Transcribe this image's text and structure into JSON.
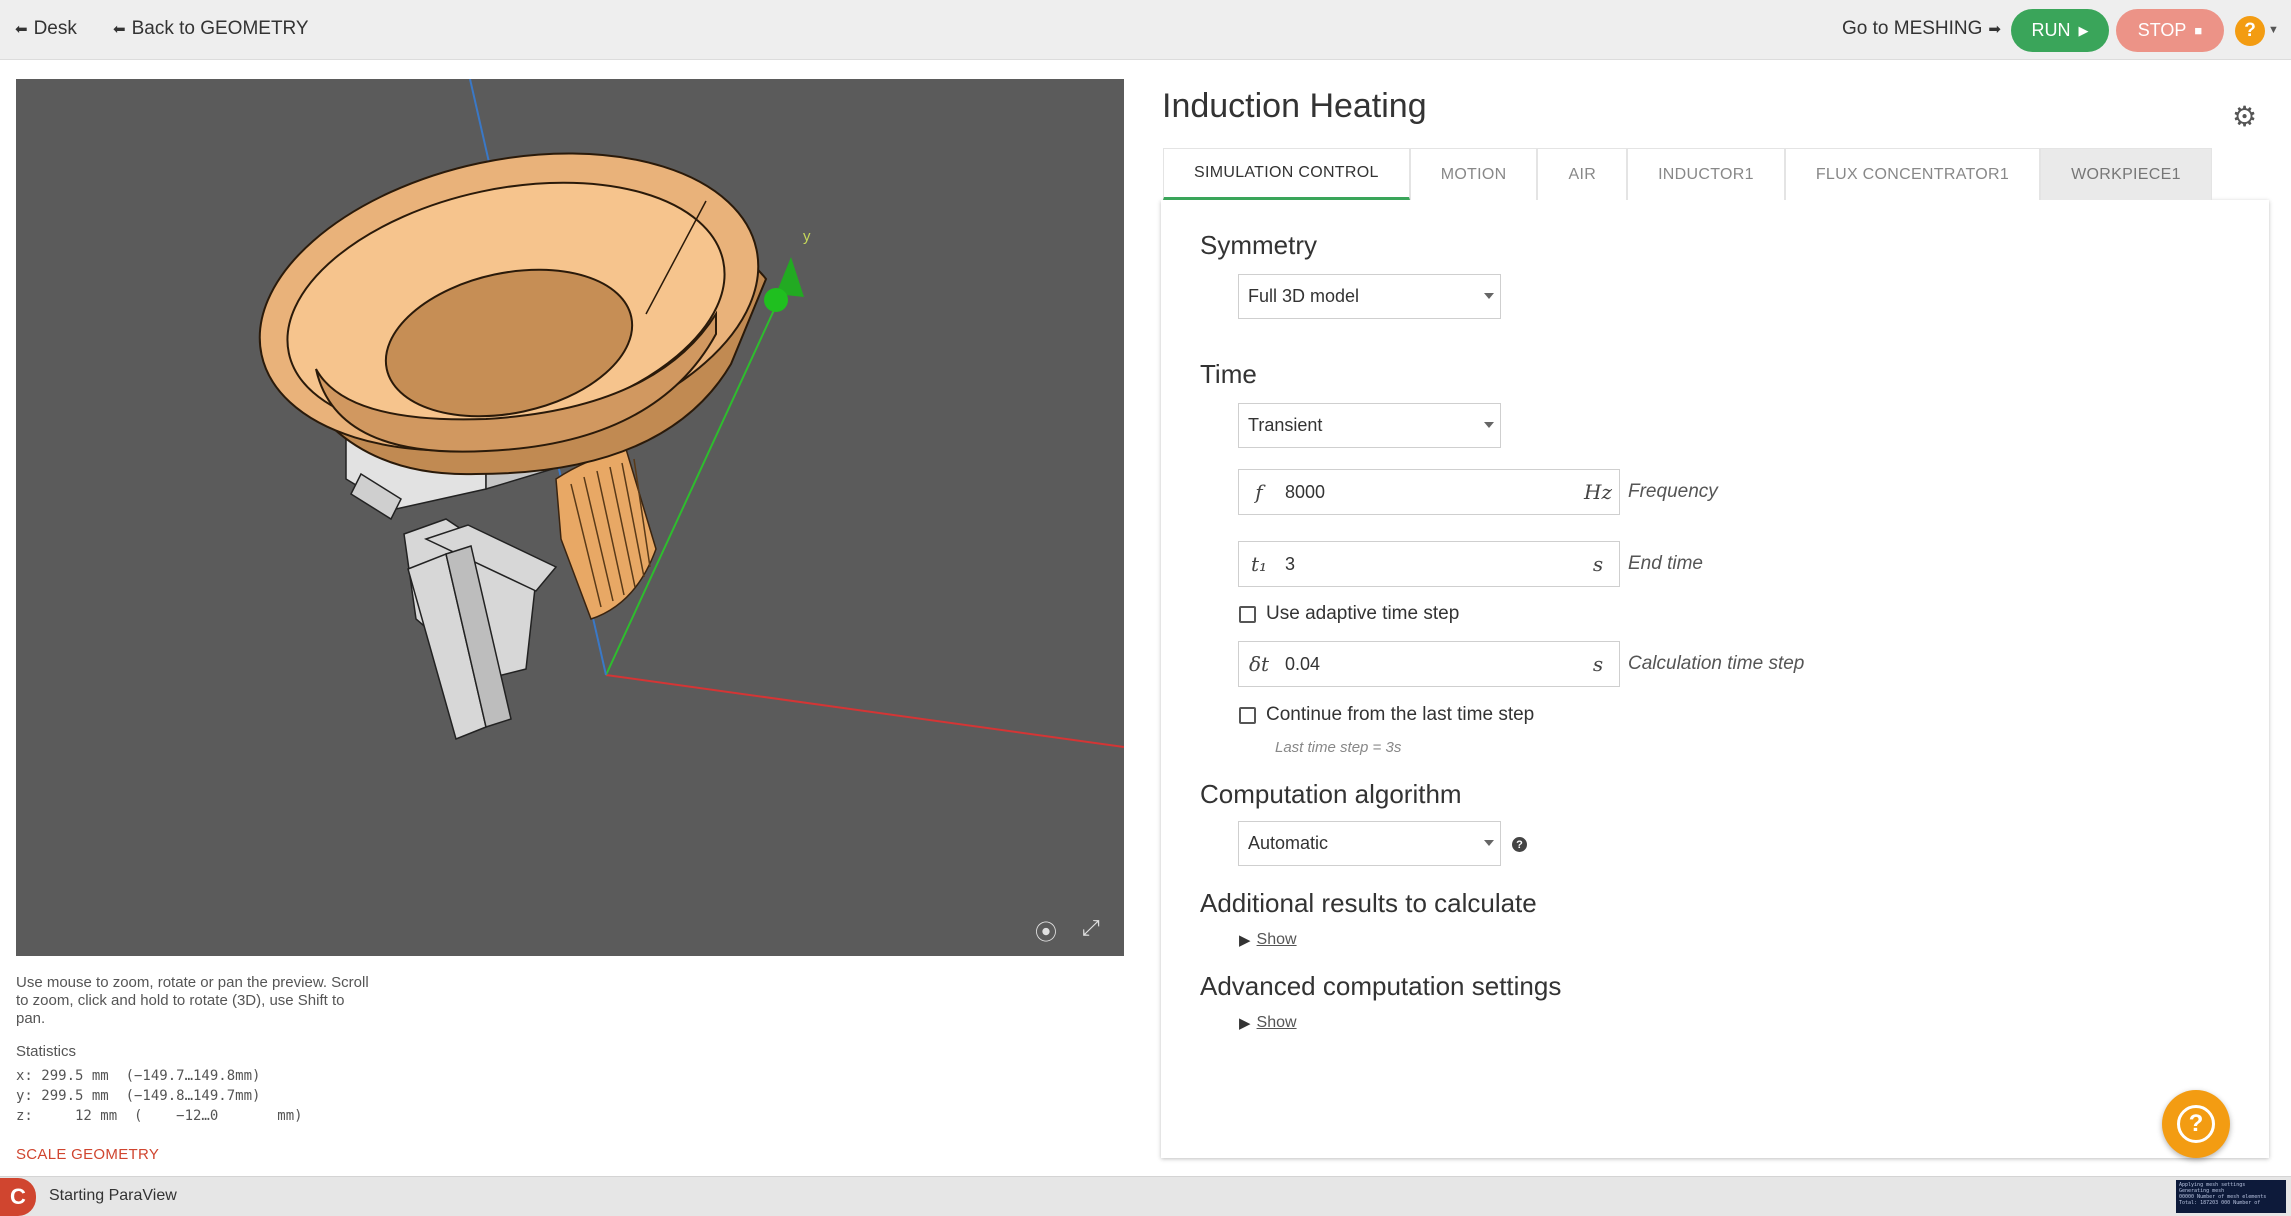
{
  "topbar": {
    "desk_label": "Desk",
    "back_label": "Back to GEOMETRY",
    "goto_label": "Go to MESHING",
    "run_label": "RUN",
    "stop_label": "STOP",
    "help_label": "?"
  },
  "viewport": {
    "axis_y_label": "y",
    "hint": "Use mouse to zoom, rotate or pan the preview. Scroll to zoom, click and hold to rotate (3D), use Shift to pan.",
    "stats_title": "Statistics",
    "stats": {
      "x": "x: 299.5 mm  (−149.7…149.8mm)",
      "y": "y: 299.5 mm  (−149.8…149.7mm)",
      "z": "z:     12 mm  (    −12…0       mm)"
    },
    "scale_label": "SCALE GEOMETRY"
  },
  "status": {
    "text": "Starting ParaView",
    "terminal": "Applying mesh settings\nGenerating mesh\n00000 Number of mesh elements\nTotal: 187203 000 Number of"
  },
  "panel": {
    "title": "Induction Heating",
    "tabs": [
      {
        "label": "SIMULATION CONTROL"
      },
      {
        "label": "MOTION"
      },
      {
        "label": "AIR"
      },
      {
        "label": "INDUCTOR1"
      },
      {
        "label": "FLUX CONCENTRATOR1"
      },
      {
        "label": "WORKPIECE1"
      }
    ],
    "symmetry": {
      "heading": "Symmetry",
      "value": "Full 3D model"
    },
    "time": {
      "heading": "Time",
      "mode": "Transient",
      "frequency": {
        "symbol": "f",
        "value": "8000",
        "unit": "Hz",
        "label": "Frequency"
      },
      "end_time": {
        "symbol": "t₁",
        "value": "3",
        "unit": "s",
        "label": "End time"
      },
      "adaptive_label": "Use adaptive time step",
      "step": {
        "symbol": "δt",
        "value": "0.04",
        "unit": "s",
        "label": "Calculation time step"
      },
      "continue_label": "Continue from the last time step",
      "last_step_hint": "Last time step = 3s"
    },
    "algorithm": {
      "heading": "Computation algorithm",
      "value": "Automatic"
    },
    "additional": {
      "heading": "Additional results to calculate",
      "show": "Show"
    },
    "advanced": {
      "heading": "Advanced computation settings",
      "show": "Show"
    }
  }
}
